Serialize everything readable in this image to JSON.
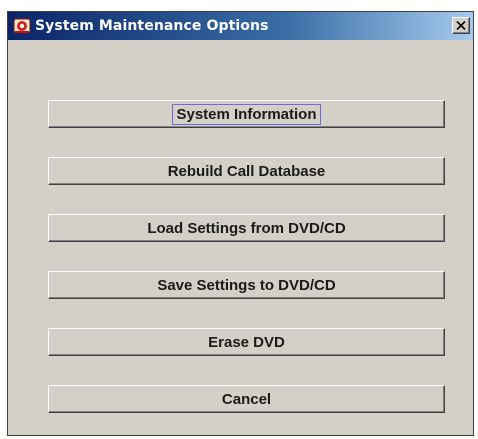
{
  "window": {
    "title": "System Maintenance Options",
    "icon": "app-icon",
    "close_icon": "close-icon"
  },
  "buttons": [
    {
      "label": "System Information",
      "focused": true
    },
    {
      "label": "Rebuild Call Database",
      "focused": false
    },
    {
      "label": "Load Settings from DVD/CD",
      "focused": false
    },
    {
      "label": "Save Settings to DVD/CD",
      "focused": false
    },
    {
      "label": "Erase DVD",
      "focused": false
    },
    {
      "label": "Cancel",
      "focused": false
    }
  ],
  "colors": {
    "titlebar_start": "#0a246a",
    "titlebar_end": "#a6caf0",
    "face": "#d4d0c8",
    "focus_outline": "#6b6bd6"
  }
}
